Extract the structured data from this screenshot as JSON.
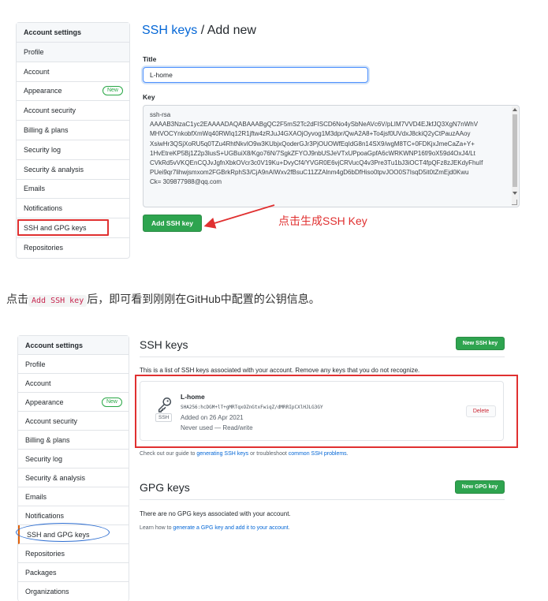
{
  "screenshot1": {
    "sidebar": {
      "header": "Account settings",
      "items": [
        {
          "label": "Profile",
          "badge": ""
        },
        {
          "label": "Account",
          "badge": ""
        },
        {
          "label": "Appearance",
          "badge": "New"
        },
        {
          "label": "Account security",
          "badge": ""
        },
        {
          "label": "Billing & plans",
          "badge": ""
        },
        {
          "label": "Security log",
          "badge": ""
        },
        {
          "label": "Security & analysis",
          "badge": ""
        },
        {
          "label": "Emails",
          "badge": ""
        },
        {
          "label": "Notifications",
          "badge": ""
        },
        {
          "label": "SSH and GPG keys",
          "badge": ""
        },
        {
          "label": "Repositories",
          "badge": ""
        }
      ],
      "active_item": "Profile",
      "highlighted_item": "SSH and GPG keys"
    },
    "breadcrumb": {
      "link": "SSH keys",
      "separator": "/",
      "current": "Add new"
    },
    "title_label": "Title",
    "title_value": "L-home",
    "key_label": "Key",
    "key_lines": [
      "ssh-rsa",
      "AAAAB3NzaC1yc2EAAAADAQABAAABgQC2F5mS2Tc2dFISCD6No4ySbNeAVc6V/pLIM7VVD4EJkfJQ3XgN7nWhV",
      "MHVOCYnkobfXmWq40RWIq12R1jftw4zRJuJ4GXAOjOyvog1M3dpr/QwA2A8+To4jsf0UVdxJ8ckiQ2yCtPauzAAoy",
      "XsiwHr3QSjXoRU5q0TZu4RhtNkvIO9w3KUbjxQoderGJr3PjOUOWfEqIdG8n14SX9/wgM8TC+0FDKjxJmeCaZa+Y+",
      "1HvEtreKP5Bj1Z2p3lusS+UGBuiX8/Kgo76N/7SgkZFYOJ9nbUSJeVTxUPpoaGpfA6cWRKWNP16f/9oX59d4OxJ4/Lt",
      "CVkRd5vVKQEnCQJvJgfnXbkOVcr3c0V19Ku+DvyCf4/YVGR0E6vjCRVucQ4v3Pre3Tu1bJ3iOCT4fpQFz8zJEKdyFhuIf",
      "PUei9qr7lihwjsmxom2FGBrkRphS3/CjA9nAIWxv2fBsuC11ZZAlnm4gD6bDfHiso0tpvJOO0S7IsqD5it0tZmEjd0Kwu",
      "Ck= 309877988@qq.com"
    ],
    "submit_button": "Add SSH key",
    "annotation": "点击生成SSH Key",
    "colors": {
      "link": "#0366d6",
      "primary_button": "#2ea44f",
      "annotation": "#e03030"
    }
  },
  "between_text": {
    "before": "点击",
    "code": "Add SSH key",
    "after": "后，即可看到刚刚在GitHub中配置的公钥信息。"
  },
  "screenshot2": {
    "sidebar": {
      "header": "Account settings",
      "items": [
        {
          "label": "Profile",
          "badge": ""
        },
        {
          "label": "Account",
          "badge": ""
        },
        {
          "label": "Appearance",
          "badge": "New"
        },
        {
          "label": "Account security",
          "badge": ""
        },
        {
          "label": "Billing & plans",
          "badge": ""
        },
        {
          "label": "Security log",
          "badge": ""
        },
        {
          "label": "Security & analysis",
          "badge": ""
        },
        {
          "label": "Emails",
          "badge": ""
        },
        {
          "label": "Notifications",
          "badge": ""
        },
        {
          "label": "SSH and GPG keys",
          "badge": ""
        },
        {
          "label": "Repositories",
          "badge": ""
        },
        {
          "label": "Packages",
          "badge": ""
        },
        {
          "label": "Organizations",
          "badge": ""
        }
      ],
      "highlighted_item": "SSH and GPG keys"
    },
    "ssh_section": {
      "title": "SSH keys",
      "new_button": "New SSH key",
      "info": "This is a list of SSH keys associated with your account. Remove any keys that you do not recognize.",
      "key": {
        "name": "L-home",
        "fingerprint": "SHA256:hcDGM+lT+gMRTqxOZnGtxFwiqZ/dMRRIpCXlHJLG3GY",
        "added": "Added on 26 Apr 2021",
        "usage": "Never used — Read/write",
        "tag": "SSH",
        "icon": "key-icon",
        "delete_button": "Delete"
      },
      "help": {
        "pre": "Check out our guide to ",
        "link1": "generating SSH keys",
        "mid": " or troubleshoot ",
        "link2": "common SSH problems",
        "post": "."
      }
    },
    "gpg_section": {
      "title": "GPG keys",
      "new_button": "New GPG key",
      "info": "There are no GPG keys associated with your account.",
      "help": {
        "pre": "Learn how to ",
        "link": "generate a GPG key and add it to your account",
        "post": "."
      }
    }
  }
}
